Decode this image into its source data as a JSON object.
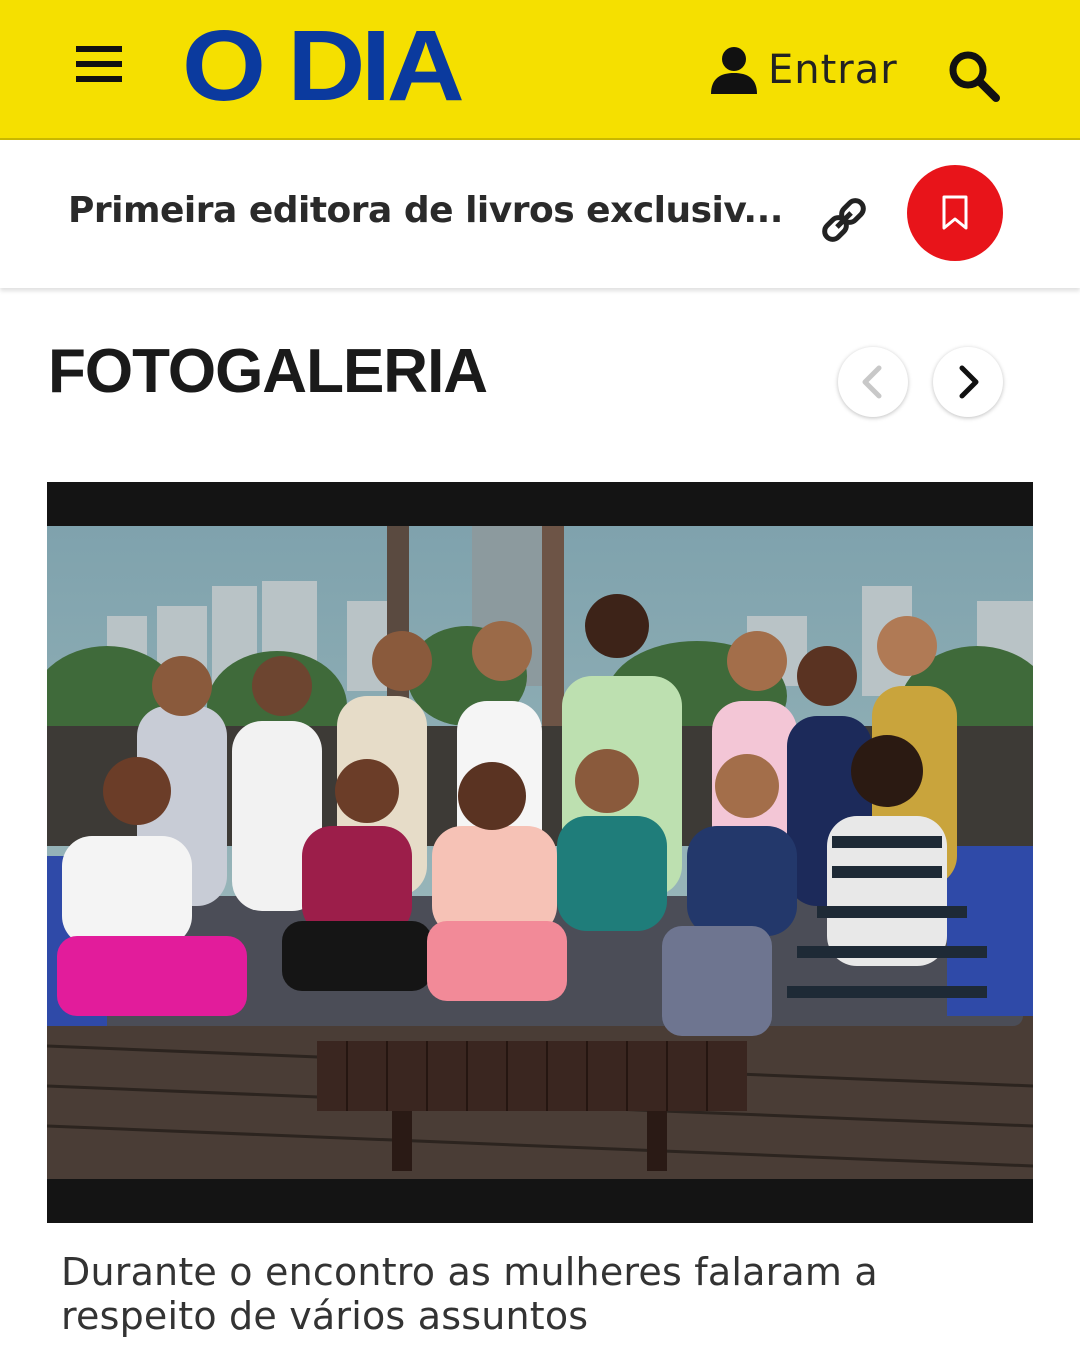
{
  "header": {
    "logo_text": "O DIA",
    "login_label": "Entrar",
    "brand_color": "#f5e000",
    "logo_color": "#0b3a9e",
    "icons": [
      "menu-icon",
      "user-icon",
      "search-icon"
    ]
  },
  "article_bar": {
    "title": "Primeira editora de livros exclusiv...",
    "icons": [
      "link-icon",
      "bookmark-icon"
    ],
    "bookmark_color": "#e8141a"
  },
  "gallery": {
    "section_title": "FOTOGALERIA",
    "icons": [
      "chevron-left-icon",
      "chevron-right-icon"
    ],
    "caption": "Durante o encontro as mulheres falaram a respeito de vários assuntos"
  }
}
